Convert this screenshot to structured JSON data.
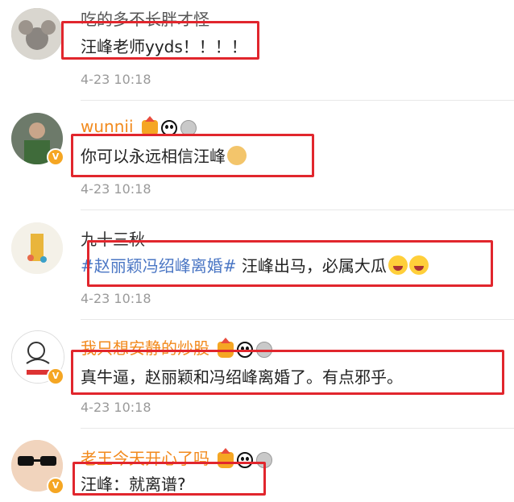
{
  "comments": [
    {
      "username": "吃的多不长胖才怪",
      "text": "汪峰老师yyds！！！！",
      "time": "4-23 10:18"
    },
    {
      "username": "wunnii",
      "text": "你可以永远相信汪峰",
      "time": "4-23 10:18"
    },
    {
      "username": "九十三秋",
      "topic": "#赵丽颖冯绍峰离婚#",
      "text": " 汪峰出马，必属大瓜",
      "time": "4-23 10:18"
    },
    {
      "username": "我只想安静的炒股",
      "text": "真牛逼，赵丽颖和冯绍峰离婚了。有点邪乎。",
      "time": "4-23 10:18"
    },
    {
      "username": "老王今天开心了吗",
      "text": "汪峰：就离谱?"
    }
  ],
  "colors": {
    "vip_name": "#f28a1d",
    "topic": "#4a76c4",
    "highlight_box": "#e1262d"
  }
}
